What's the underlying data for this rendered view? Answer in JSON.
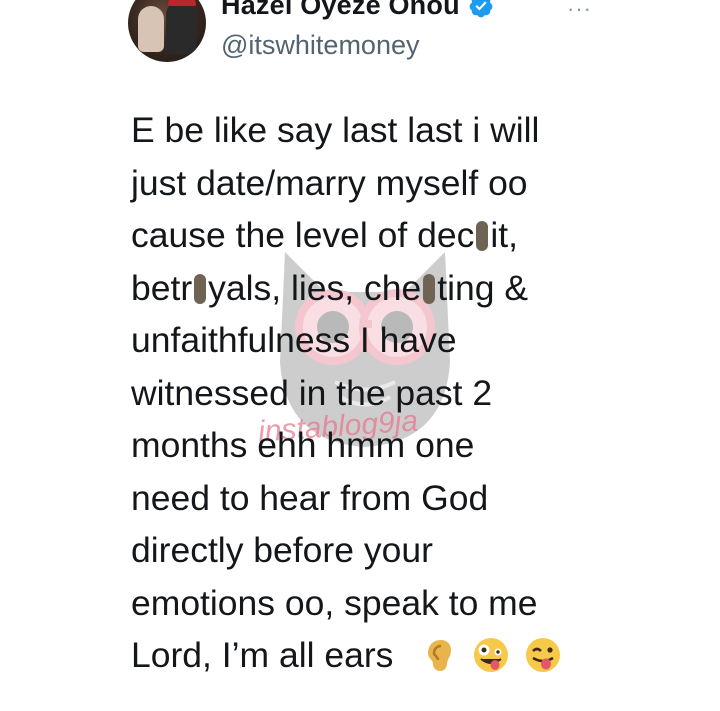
{
  "profile": {
    "display_name": "Hazel Oyeze Onou",
    "handle": "@itswhitemoney",
    "verified_icon": "verified-badge-icon",
    "more_icon": "more-options-icon"
  },
  "tweet": {
    "lines": [
      "E be like say last last i will",
      "just date/marry myself oo",
      "cause the level of dec",
      "it,",
      "betr",
      "yals, lies, che",
      "ting &",
      "unfaithfulness I have",
      "witnessed in the past 2",
      "months ehh hmm one",
      "need to hear from God",
      "directly before your",
      "emotions oo, speak to me",
      "Lord, I’m all ears"
    ],
    "emojis": [
      "ear-emoji",
      "zany-face-emoji",
      "winking-tongue-emoji"
    ]
  },
  "watermark": {
    "text": "instablog9ja",
    "logo": "owl-logo"
  },
  "colors": {
    "text": "#14171a",
    "secondary": "#536471",
    "verified": "#1d9bf0",
    "censor": "#6f6453",
    "watermark_pink": "#e77a8d"
  }
}
